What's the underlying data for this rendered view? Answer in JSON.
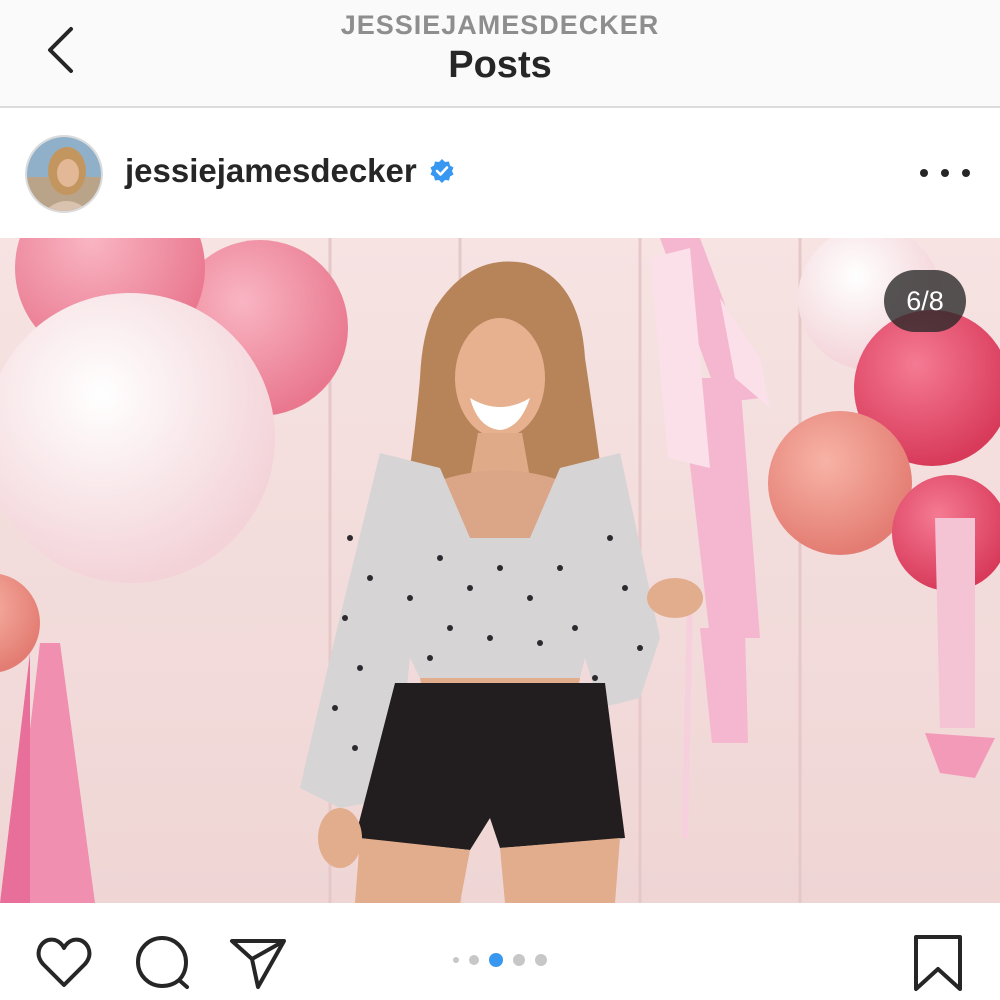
{
  "header": {
    "account": "JESSIEJAMESDECKER",
    "title": "Posts"
  },
  "post": {
    "username": "jessiejamesdecker",
    "verified": true,
    "carousel_position": "6/8",
    "carousel_dots": 5,
    "active_dot": 2
  },
  "icons": {
    "back": "chevron-left-icon",
    "verified": "verified-badge-icon",
    "more": "more-options-icon",
    "like": "heart-icon",
    "comment": "comment-icon",
    "share": "paper-plane-icon",
    "save": "bookmark-icon"
  },
  "colors": {
    "verified_blue": "#3897f0",
    "active_dot": "#3897f0",
    "text": "#262626"
  }
}
